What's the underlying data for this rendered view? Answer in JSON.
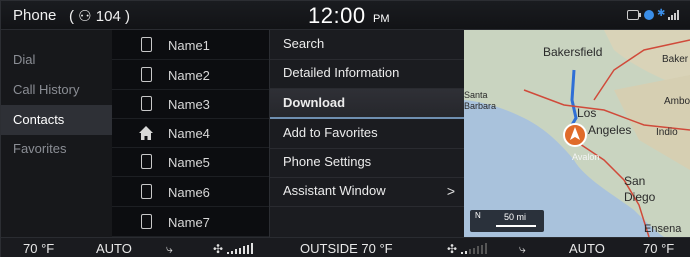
{
  "header": {
    "app_title": "Phone",
    "contact_count": "( ⚇ 104 )",
    "time": "12:00",
    "ampm": "PM"
  },
  "nav": {
    "items": [
      {
        "label": "Dial",
        "active": false
      },
      {
        "label": "Call History",
        "active": false
      },
      {
        "label": "Contacts",
        "active": true
      },
      {
        "label": "Favorites",
        "active": false
      }
    ]
  },
  "contacts": {
    "rows": [
      {
        "name": "Name1",
        "icon": "phone-icon"
      },
      {
        "name": "Name2",
        "icon": "phone-icon"
      },
      {
        "name": "Name3",
        "icon": "phone-icon"
      },
      {
        "name": "Name4",
        "icon": "home-icon"
      },
      {
        "name": "Name5",
        "icon": "phone-icon"
      },
      {
        "name": "Name6",
        "icon": "phone-icon"
      },
      {
        "name": "Name7",
        "icon": "phone-icon"
      }
    ]
  },
  "menu": {
    "items": [
      {
        "label": "Search"
      },
      {
        "label": "Detailed Information"
      },
      {
        "label": "Download",
        "active": true
      },
      {
        "label": "Add to Favorites"
      },
      {
        "label": "Phone Settings"
      },
      {
        "label": "Assistant Window",
        "arrow": ">"
      }
    ]
  },
  "map": {
    "labels": [
      "Bakersfield",
      "Los",
      "Angeles",
      "Indio",
      "Avalon",
      "San",
      "Diego",
      "Santa",
      "Barbara",
      "Baker",
      "Ambo",
      "Ensena"
    ],
    "scale": "50 mi",
    "north": "N",
    "colors": {
      "land": "#c8d3c2",
      "sea": "#a9c2dc",
      "road_blue": "#2f6fd6",
      "road_red": "#d04a3a"
    }
  },
  "climate": {
    "left_temp": "70 °F",
    "left_mode": "AUTO",
    "outside": "OUTSIDE  70 °F",
    "right_mode": "AUTO",
    "right_temp": "70 °F"
  }
}
